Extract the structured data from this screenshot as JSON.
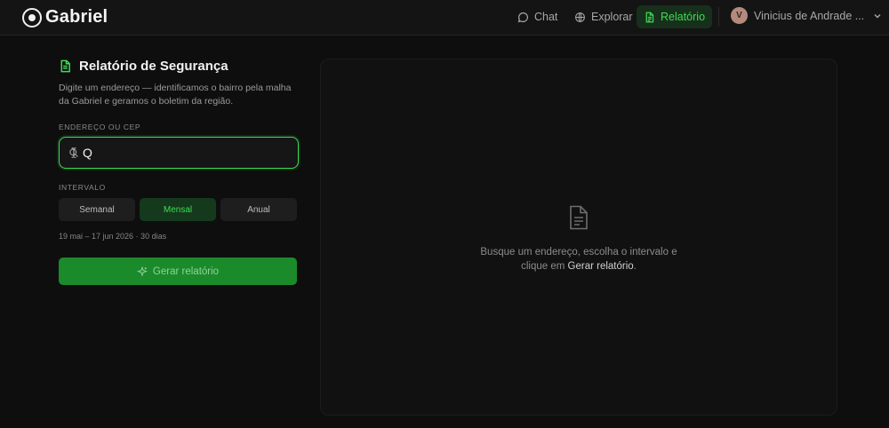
{
  "app": {
    "name": "Gabriel"
  },
  "nav": {
    "chat_label": "Chat",
    "explore_label": "Explorar",
    "report_label": "Relatório",
    "active": "report"
  },
  "user": {
    "initial": "V",
    "name": "Vinicius de Andrade ..."
  },
  "report": {
    "title": "Relatório de Segurança",
    "description": "Digite um endereço — identificamos o bairro pela malha da Gabriel e geramos o boletim da região.",
    "address_label": "ENDEREÇO OU CEP",
    "address_value": "Q",
    "interval_label": "INTERVALO",
    "intervals": [
      "Semanal",
      "Mensal",
      "Anual"
    ],
    "selected_interval": "Mensal",
    "range_text": "19 mai – 17 jun 2026 · 30 dias",
    "generate_label": "Gerar relatório"
  },
  "empty_state": {
    "line1": "Busque um endereço, escolha o intervalo e",
    "line2_prefix": "clique em",
    "line2_action": "Gerar relatório",
    "line2_suffix": "."
  },
  "colors": {
    "accent": "#3ddc53",
    "button_bg": "#1b8a2b",
    "background": "#0e0e0e"
  }
}
